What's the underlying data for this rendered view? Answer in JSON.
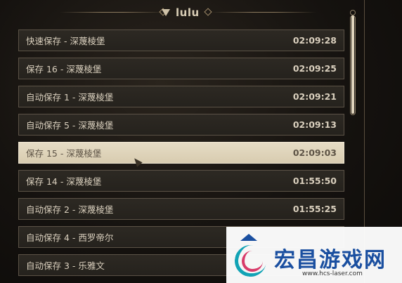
{
  "header": {
    "title": "lulu"
  },
  "saves": [
    {
      "name": "快速保存 - 深蔑棱堡",
      "time": "02:09:28",
      "selected": false
    },
    {
      "name": "保存 16 - 深蔑棱堡",
      "time": "02:09:25",
      "selected": false
    },
    {
      "name": "自动保存 1 - 深蔑棱堡",
      "time": "02:09:21",
      "selected": false
    },
    {
      "name": "自动保存 5 - 深蔑棱堡",
      "time": "02:09:13",
      "selected": false
    },
    {
      "name": "保存 15 - 深蔑棱堡",
      "time": "02:09:03",
      "selected": true
    },
    {
      "name": "保存 14 - 深蔑棱堡",
      "time": "01:55:50",
      "selected": false
    },
    {
      "name": "自动保存 2 - 深蔑棱堡",
      "time": "01:55:25",
      "selected": false
    },
    {
      "name": "自动保存 4 - 西罗帝尔",
      "time": "",
      "selected": false
    },
    {
      "name": "自动保存 3 - 乐雅文",
      "time": "",
      "selected": false
    }
  ],
  "watermark": {
    "title": "宏昌游戏网",
    "url": "www.hcs-laser.com"
  }
}
